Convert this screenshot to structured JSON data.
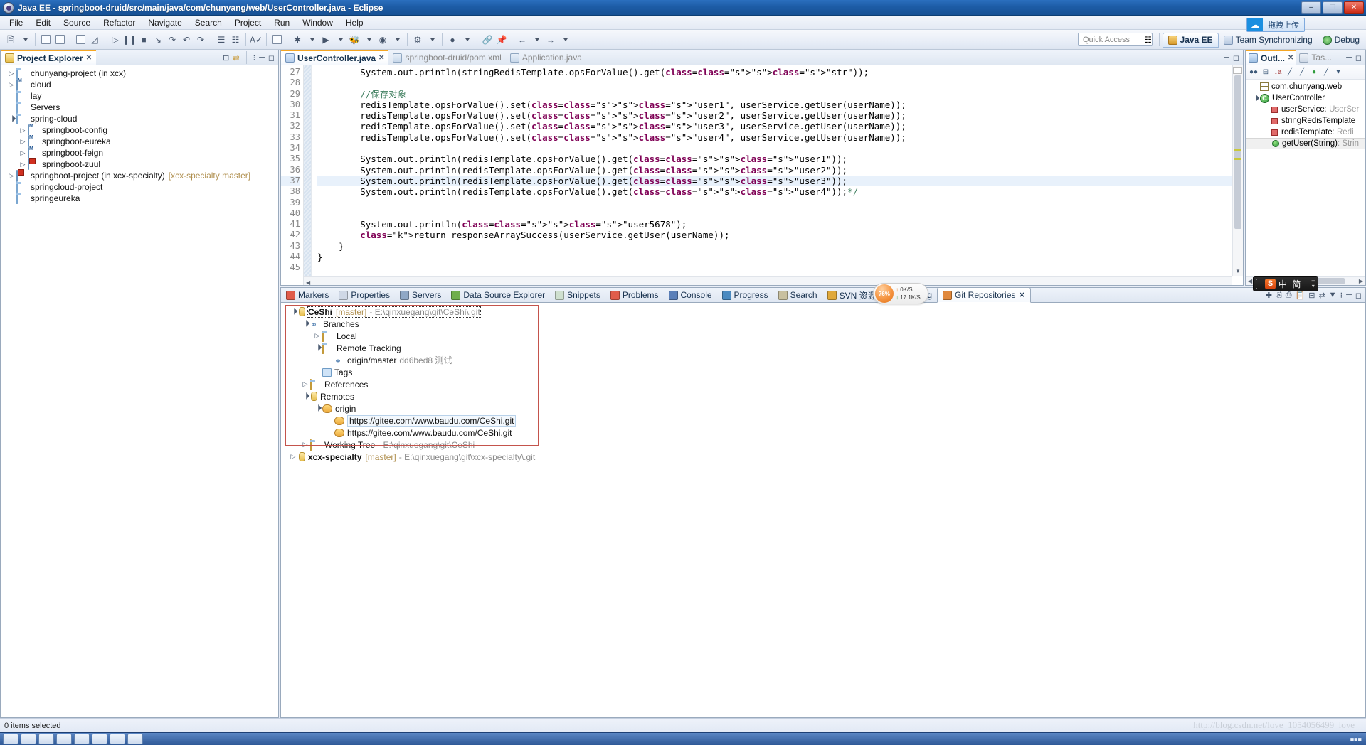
{
  "window": {
    "title": "Java EE - springboot-druid/src/main/java/com/chunyang/web/UserController.java - Eclipse",
    "app_icon": "eclipse-icon",
    "minimize": "–",
    "maximize": "❐",
    "close": "✕"
  },
  "menubar": [
    {
      "label": "File"
    },
    {
      "label": "Edit"
    },
    {
      "label": "Source"
    },
    {
      "label": "Refactor"
    },
    {
      "label": "Navigate"
    },
    {
      "label": "Search"
    },
    {
      "label": "Project"
    },
    {
      "label": "Run"
    },
    {
      "label": "Window"
    },
    {
      "label": "Help"
    }
  ],
  "toolbar": {
    "quick_access_placeholder": "Quick Access",
    "upload_badge": "拖拽上传",
    "perspectives": [
      {
        "label": "Java EE",
        "active": true
      },
      {
        "label": "Team Synchronizing",
        "active": false
      },
      {
        "label": "Debug",
        "active": false
      }
    ]
  },
  "project_explorer": {
    "tab_label": "Project Explorer",
    "tab_close": "✕",
    "items": [
      {
        "indent": 0,
        "arrow": "closed",
        "icon": "folder-icon",
        "label": "chunyang-project (in xcx)"
      },
      {
        "indent": 0,
        "arrow": "closed",
        "icon": "maven-icon",
        "label": "cloud"
      },
      {
        "indent": 0,
        "arrow": "none",
        "icon": "folder-icon",
        "label": "lay"
      },
      {
        "indent": 0,
        "arrow": "none",
        "icon": "folder-icon",
        "label": "Servers"
      },
      {
        "indent": 0,
        "arrow": "open",
        "icon": "folder-icon",
        "label": "spring-cloud"
      },
      {
        "indent": 1,
        "arrow": "closed",
        "icon": "maven-icon",
        "label": "springboot-config"
      },
      {
        "indent": 1,
        "arrow": "closed",
        "icon": "maven-icon",
        "label": "springboot-eureka"
      },
      {
        "indent": 1,
        "arrow": "closed",
        "icon": "maven-icon",
        "label": "springboot-feign"
      },
      {
        "indent": 1,
        "arrow": "closed",
        "icon": "maven-error-icon",
        "label": "springboot-zuul"
      },
      {
        "indent": 0,
        "arrow": "closed",
        "icon": "maven-error-icon",
        "label": "springboot-project (in xcx-specialty)",
        "branch": "[xcx-specialty master]"
      },
      {
        "indent": 0,
        "arrow": "none",
        "icon": "folder-icon",
        "label": "springcloud-project"
      },
      {
        "indent": 0,
        "arrow": "none",
        "icon": "folder-icon",
        "label": "springeureka"
      }
    ]
  },
  "editor": {
    "tabs": [
      {
        "label": "UserController.java",
        "icon": "java-file-icon",
        "active": true,
        "close": "✕"
      },
      {
        "label": "springboot-druid/pom.xml",
        "icon": "maven-file-icon",
        "active": false
      },
      {
        "label": "Application.java",
        "icon": "java-file-icon",
        "active": false
      }
    ],
    "first_line": 27,
    "highlight_line": 37,
    "lines": [
      {
        "n": 27,
        "text": "        System.out.println(stringRedisTemplate.opsForValue().get(\"str\"));"
      },
      {
        "n": 28,
        "text": ""
      },
      {
        "n": 29,
        "text": "        //保存对象"
      },
      {
        "n": 30,
        "text": "        redisTemplate.opsForValue().set(\"user1\", userService.getUser(userName));"
      },
      {
        "n": 31,
        "text": "        redisTemplate.opsForValue().set(\"user2\", userService.getUser(userName));"
      },
      {
        "n": 32,
        "text": "        redisTemplate.opsForValue().set(\"user3\", userService.getUser(userName));"
      },
      {
        "n": 33,
        "text": "        redisTemplate.opsForValue().set(\"user4\", userService.getUser(userName));"
      },
      {
        "n": 34,
        "text": ""
      },
      {
        "n": 35,
        "text": "        System.out.println(redisTemplate.opsForValue().get(\"user1\"));"
      },
      {
        "n": 36,
        "text": "        System.out.println(redisTemplate.opsForValue().get(\"user2\"));"
      },
      {
        "n": 37,
        "text": "        System.out.println(redisTemplate.opsForValue().get(\"user3\"));"
      },
      {
        "n": 38,
        "text": "        System.out.println(redisTemplate.opsForValue().get(\"user4\"));*/"
      },
      {
        "n": 39,
        "text": ""
      },
      {
        "n": 40,
        "text": ""
      },
      {
        "n": 41,
        "text": "        System.out.println(\"user5678\");"
      },
      {
        "n": 42,
        "text": "        return responseArraySuccess(userService.getUser(userName));"
      },
      {
        "n": 43,
        "text": "    }"
      },
      {
        "n": 44,
        "text": "}"
      },
      {
        "n": 45,
        "text": ""
      }
    ]
  },
  "outline": {
    "tabs": [
      {
        "label": "Outl...",
        "active": true,
        "close": "✕"
      },
      {
        "label": "Tas...",
        "active": false
      }
    ],
    "tool_icons": [
      "collapse-all-icon",
      "focus-icon",
      "sort-alpha-icon",
      "hide-fields-icon",
      "hide-static-icon",
      "hide-nonpublic-icon",
      "hide-local-icon",
      "view-menu-icon"
    ],
    "items": [
      {
        "indent": 0,
        "arrow": "none",
        "icon": "package-icon",
        "label": "com.chunyang.web",
        "type": ""
      },
      {
        "indent": 0,
        "arrow": "open",
        "icon": "class-icon",
        "label": "UserController",
        "type": ""
      },
      {
        "indent": 1,
        "arrow": "none",
        "icon": "field-icon",
        "label": "userService",
        "type": ": UserSer"
      },
      {
        "indent": 1,
        "arrow": "none",
        "icon": "field-icon",
        "label": "stringRedisTemplate",
        "type": ""
      },
      {
        "indent": 1,
        "arrow": "none",
        "icon": "field-icon",
        "label": "redisTemplate",
        "type": ": Redi"
      },
      {
        "indent": 1,
        "arrow": "none",
        "icon": "method-icon",
        "label": "getUser(String)",
        "type": ": Strin",
        "selected": true
      }
    ]
  },
  "bottom_panel": {
    "tabs": [
      {
        "label": "Markers",
        "icon": "markers-icon",
        "active": false
      },
      {
        "label": "Properties",
        "icon": "properties-icon",
        "active": false
      },
      {
        "label": "Servers",
        "icon": "servers-icon",
        "active": false
      },
      {
        "label": "Data Source Explorer",
        "icon": "datasource-icon",
        "active": false
      },
      {
        "label": "Snippets",
        "icon": "snippets-icon",
        "active": false
      },
      {
        "label": "Problems",
        "icon": "problems-icon",
        "active": false
      },
      {
        "label": "Console",
        "icon": "console-icon",
        "active": false
      },
      {
        "label": "Progress",
        "icon": "progress-icon",
        "active": false
      },
      {
        "label": "Search",
        "icon": "search-icon",
        "active": false
      },
      {
        "label": "SVN 资源库",
        "icon": "svn-icon",
        "active": false
      },
      {
        "label": "Debug",
        "icon": "debug-icon",
        "active": false
      },
      {
        "label": "Git Repositories",
        "icon": "git-icon",
        "active": true,
        "close": "✕"
      }
    ],
    "git_tree": [
      {
        "indent": 0,
        "arrow": "open",
        "icon": "repo-icon",
        "label": "CeShi",
        "branch": "[master]",
        "path": "- E:\\qinxuegang\\git\\CeShi\\.git",
        "focus": true
      },
      {
        "indent": 1,
        "arrow": "open",
        "icon": "branches-icon",
        "label": "Branches"
      },
      {
        "indent": 2,
        "arrow": "closed",
        "icon": "folder-icon",
        "label": "Local"
      },
      {
        "indent": 2,
        "arrow": "open",
        "icon": "folder-icon",
        "label": "Remote Tracking"
      },
      {
        "indent": 3,
        "arrow": "none",
        "icon": "branch-icon",
        "label": "origin/master",
        "commit": "dd6bed8 测试"
      },
      {
        "indent": 2,
        "arrow": "none",
        "icon": "tags-icon",
        "label": "Tags"
      },
      {
        "indent": 1,
        "arrow": "closed",
        "icon": "folder-icon",
        "label": "References"
      },
      {
        "indent": 1,
        "arrow": "open",
        "icon": "repo-icon",
        "label": "Remotes"
      },
      {
        "indent": 2,
        "arrow": "open",
        "icon": "remote-icon",
        "label": "origin"
      },
      {
        "indent": 3,
        "arrow": "none",
        "icon": "fetch-icon",
        "label": "https://gitee.com/www.baudu.com/CeShi.git",
        "selected": true
      },
      {
        "indent": 3,
        "arrow": "none",
        "icon": "push-icon",
        "label": "https://gitee.com/www.baudu.com/CeShi.git"
      },
      {
        "indent": 1,
        "arrow": "closed",
        "icon": "folder-icon",
        "label": "Working Tree",
        "path": "- E:\\qinxuegang\\git\\CeShi"
      },
      {
        "indent": 0,
        "arrow": "closed",
        "icon": "repo-icon",
        "label": "xcx-specialty",
        "branch": "[master]",
        "path": "- E:\\qinxuegang\\git\\xcx-specialty\\.git"
      }
    ]
  },
  "network_widget": {
    "percent": "76%",
    "upload": "0K/S",
    "download": "17.1K/S",
    "up_arrow": "↑",
    "down_arrow": "↓"
  },
  "ime": {
    "logo": "S",
    "mode": "中 简",
    "minimize": "–",
    "menu": "▾"
  },
  "statusbar": {
    "message": "0 items selected",
    "watermark": "http://blog.csdn.net/love_1054056499_love"
  }
}
